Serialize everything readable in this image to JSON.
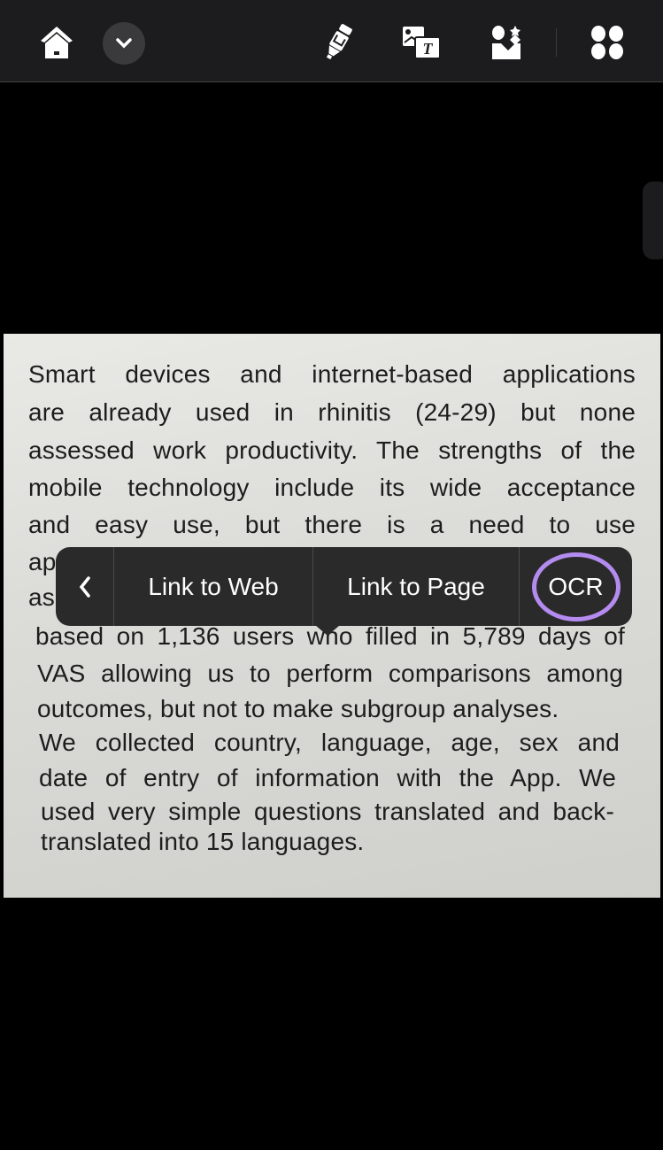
{
  "toolbar": {
    "icons": [
      "home-icon",
      "chevron-down-icon",
      "highlighter-icon",
      "image-to-text-icon",
      "ai-image-icon",
      "apps-grid-icon"
    ]
  },
  "photo": {
    "lines": [
      "Smart devices and internet-based applications",
      "are already used in rhinitis (24-29) but none",
      "assessed work productivity. The strengths of the",
      "mobile technology include its wide acceptance",
      "and easy use, but there is a need to use",
      "ap",
      "as",
      "based on 1,136 users who filled in 5,789 days of",
      "VAS allowing us to perform comparisons among",
      "outcomes, but not to make subgroup analyses.",
      "We collected country, language, age, sex and",
      "date of entry of information with the App. We",
      "used very simple questions translated and back-",
      "translated into 15 languages."
    ]
  },
  "context_menu": {
    "back": "<",
    "items": [
      "Link to Web",
      "Link to Page",
      "OCR"
    ],
    "highlight_color": "#b48cf0"
  }
}
